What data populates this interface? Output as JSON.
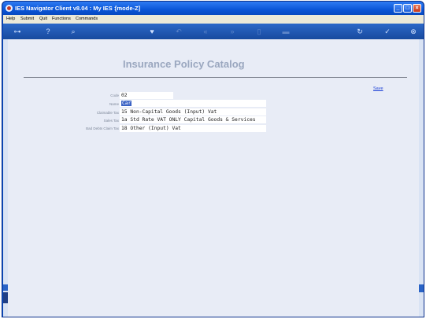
{
  "window": {
    "title": "IES Navigator Client v8.04 : My IES :",
    "mode": "[mode-Z]",
    "controls": {
      "minimize": "_",
      "maximize": "□",
      "close": "×"
    }
  },
  "menu": {
    "items": [
      "Help",
      "Submit",
      "Quit",
      "Functions",
      "Commands"
    ]
  },
  "toolbar": {
    "icons": [
      "key-icon",
      "help-icon",
      "search-icon",
      "heart-icon",
      "undo-icon",
      "back-icon",
      "forward-icon",
      "page-icon",
      "home-icon",
      "refresh-icon",
      "check-icon",
      "close-icon"
    ]
  },
  "page": {
    "title": "Insurance Policy Catalog",
    "save_label": "Save"
  },
  "form": {
    "fields": [
      {
        "label": "Code",
        "value": "02"
      },
      {
        "label": "Name",
        "value": "Car"
      },
      {
        "label": "Claimable Tax",
        "value": "15 Non-Capital Goods (Input) Vat"
      },
      {
        "label": "Sales Tax",
        "value": "1a Std Rate VAT ONLY Capital Goods & Services"
      },
      {
        "label": "Bad Debts Claim Tax",
        "value": "18 Other (Input) Vat"
      }
    ]
  }
}
